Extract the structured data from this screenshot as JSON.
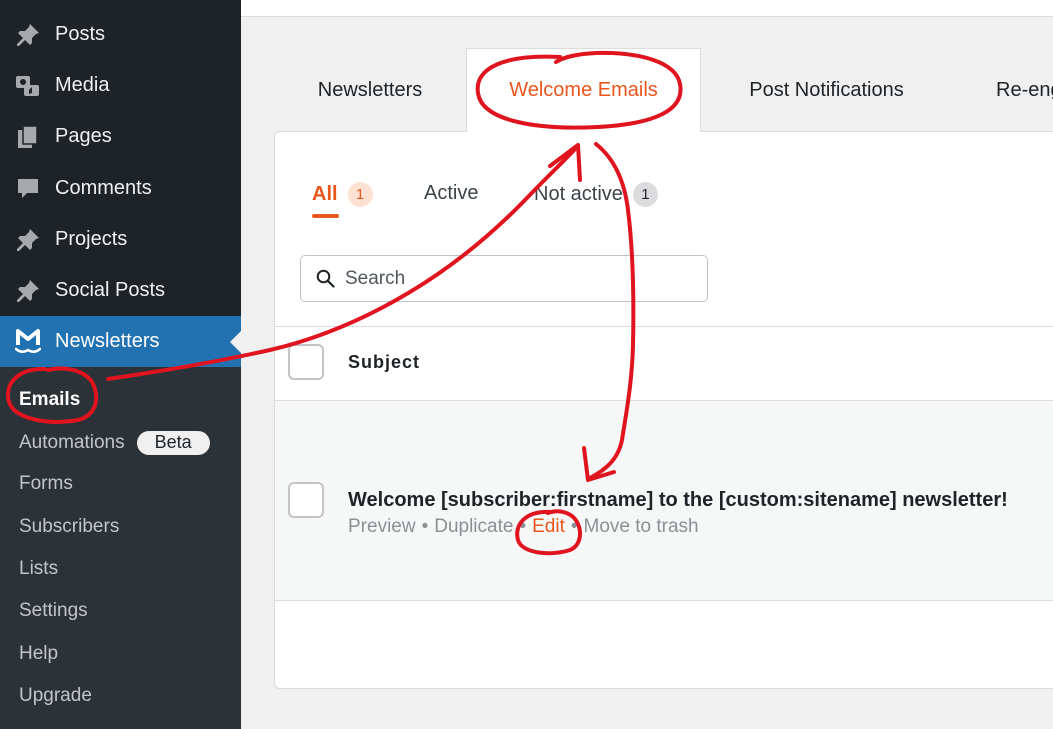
{
  "sidebar": {
    "menu": [
      {
        "label": "Posts",
        "icon": "pin-icon"
      },
      {
        "label": "Media",
        "icon": "media-icon"
      },
      {
        "label": "Pages",
        "icon": "pages-icon"
      },
      {
        "label": "Comments",
        "icon": "comment-icon"
      },
      {
        "label": "Projects",
        "icon": "pin-icon"
      },
      {
        "label": "Social Posts",
        "icon": "pin-icon"
      },
      {
        "label": "Newsletters",
        "icon": "mailpoet-logo-icon",
        "current": true
      }
    ],
    "submenu": [
      {
        "label": "Emails",
        "current": true
      },
      {
        "label": "Automations",
        "badge": "Beta"
      },
      {
        "label": "Forms"
      },
      {
        "label": "Subscribers"
      },
      {
        "label": "Lists"
      },
      {
        "label": "Settings"
      },
      {
        "label": "Help"
      },
      {
        "label": "Upgrade"
      }
    ]
  },
  "tabs": [
    {
      "label": "Newsletters"
    },
    {
      "label": "Welcome Emails",
      "active": true
    },
    {
      "label": "Post Notifications"
    },
    {
      "label": "Re-eng"
    }
  ],
  "filters": [
    {
      "label": "All",
      "count": "1",
      "active": true
    },
    {
      "label": "Active"
    },
    {
      "label": "Not active",
      "count": "1"
    }
  ],
  "search": {
    "placeholder": "Search",
    "value": ""
  },
  "table": {
    "column_subject": "Subject",
    "rows": [
      {
        "subject": "Welcome [subscriber:firstname] to the [custom:sitename] newsletter!",
        "actions": [
          "Preview",
          "Duplicate",
          "Edit",
          "Move to trash"
        ],
        "separator": "•"
      }
    ]
  },
  "colors": {
    "accent": "#e8561d",
    "sidebar_bg": "#1d2327",
    "submenu_bg": "#2c3338",
    "current_menu_bg": "#2271b1",
    "annotation_red": "#e0141e"
  }
}
